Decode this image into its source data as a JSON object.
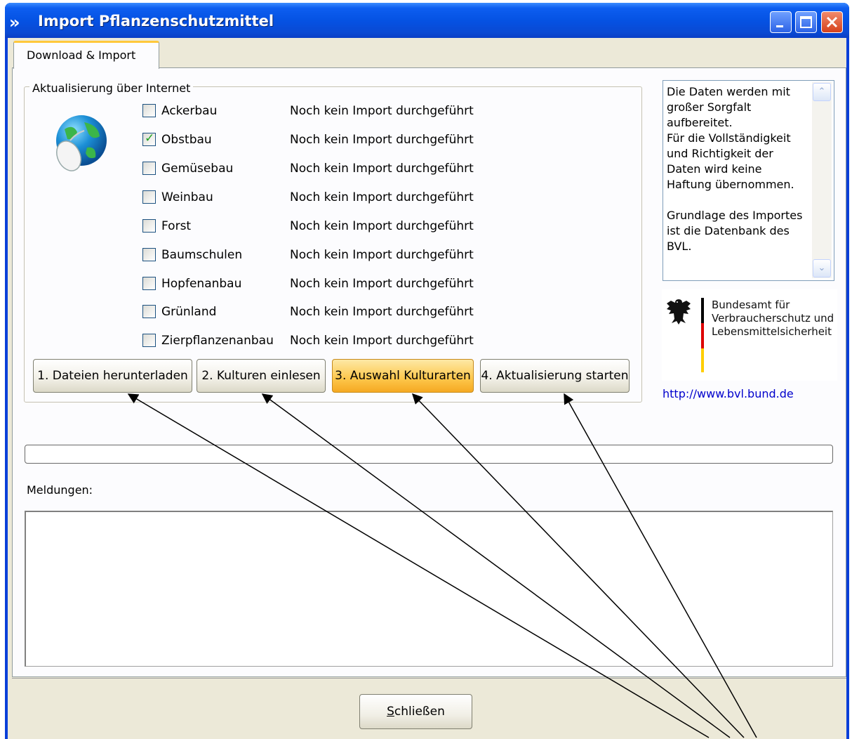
{
  "window": {
    "title": "Import Pflanzenschutzmittel",
    "app_icon": "»",
    "controls": [
      "minimize-icon",
      "maximize-icon",
      "close-icon"
    ]
  },
  "tabs": [
    {
      "label": "Download & Import",
      "selected": true
    }
  ],
  "group": {
    "title": "Aktualisierung über Internet",
    "icon": "globe-mouse-icon",
    "items": [
      {
        "label": "Ackerbau",
        "checked": false,
        "status": "Noch kein Import durchgeführt"
      },
      {
        "label": "Obstbau",
        "checked": true,
        "status": "Noch kein Import durchgeführt"
      },
      {
        "label": "Gemüsebau",
        "checked": false,
        "status": "Noch kein Import durchgeführt"
      },
      {
        "label": "Weinbau",
        "checked": false,
        "status": "Noch kein Import durchgeführt"
      },
      {
        "label": "Forst",
        "checked": false,
        "status": "Noch kein Import durchgeführt"
      },
      {
        "label": "Baumschulen",
        "checked": false,
        "status": "Noch kein Import durchgeführt"
      },
      {
        "label": "Hopfenanbau",
        "checked": false,
        "status": "Noch kein Import durchgeführt"
      },
      {
        "label": "Grünland",
        "checked": false,
        "status": "Noch kein Import durchgeführt"
      },
      {
        "label": "Zierpflanzenanbau",
        "checked": false,
        "status": "Noch kein Import durchgeführt"
      }
    ],
    "buttons": [
      {
        "label": "1. Dateien herunterladen"
      },
      {
        "label": "2. Kulturen einlesen"
      },
      {
        "label": "3. Auswahl Kulturarten",
        "highlighted": true
      },
      {
        "label": "4. Aktualisierung starten"
      }
    ]
  },
  "info": {
    "text": "Die Daten werden mit\ngroßer Sorgfalt\naufbereitet.\nFür die Vollständigkeit\nund Richtigkeit der\nDaten wird keine\nHaftung übernommen.\n\nGrundlage des Importes\nist die Datenbank des\nBVL.",
    "scroll_up": "⌃",
    "scroll_down": "⌄"
  },
  "bvl": {
    "name": "Bundesamt für\nVerbraucherschutz und\nLebensmittelsicherheit",
    "link": "http://www.bvl.bund.de"
  },
  "progress": {
    "value": 0
  },
  "messages": {
    "label": "Meldungen:",
    "content": ""
  },
  "footer": {
    "close_label_prefix": "S",
    "close_label_rest": "chließen"
  },
  "colors": {
    "titlebar": "#0552e3",
    "highlight_button": "#fdc64a",
    "link": "#0000cc"
  }
}
